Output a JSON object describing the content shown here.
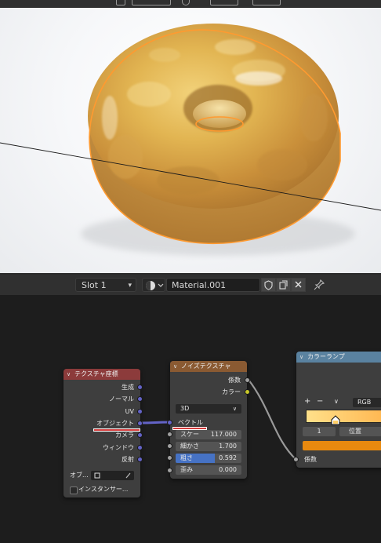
{
  "header": {
    "slot_label": "Slot 1",
    "material_name": "Material.001"
  },
  "colors": {
    "texcoord_header": "#8c3b3b",
    "noise_header": "#8a5a32",
    "colorramp_header": "#5a82a0",
    "vector_socket": "#6363c7",
    "float_socket": "#a1a1a1",
    "color_socket": "#c7c729",
    "ramp_gradient_start": "#ffe08a",
    "ramp_gradient_end": "#ffb24a",
    "ramp_color_preview": "#e8890f",
    "highlight_field": "#4672c4"
  },
  "nodes": {
    "tex_coord": {
      "title": "テクスチャ座標",
      "outputs": [
        "生成",
        "ノーマル",
        "UV",
        "オブジェクト",
        "カメラ",
        "ウィンドウ",
        "反射"
      ],
      "object_label": "オブ...",
      "instancer_label": "インスタンサー..."
    },
    "noise": {
      "title": "ノイズテクスチャ",
      "out_fac": "係数",
      "out_color": "カラー",
      "dimension": "3D",
      "in_vector": "ベクトル",
      "scale_label": "スケー",
      "scale_value": "117.000",
      "detail_label": "細かさ",
      "detail_value": "1.700",
      "roughness_label": "粗さ",
      "roughness_value": "0.592",
      "distortion_label": "歪み",
      "distortion_value": "0.000"
    },
    "color_ramp": {
      "title": "カラーランプ",
      "add_btn": "+",
      "remove_btn": "−",
      "more_btn": "∨",
      "mode": "RGB",
      "stop_index": "1",
      "position_label": "位置",
      "in_fac": "係数"
    }
  }
}
